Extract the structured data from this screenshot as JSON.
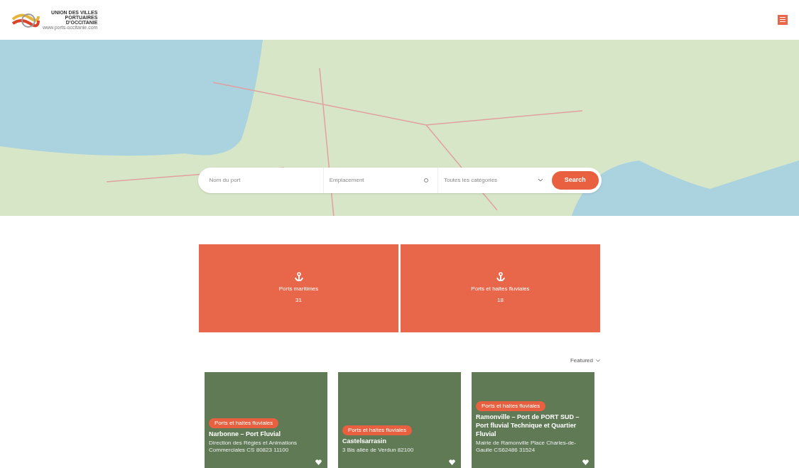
{
  "header": {
    "logo_lines": [
      "UNION DES VILLES",
      "PORTUAIRES",
      "D'OCCITANIE"
    ],
    "logo_url": "www.ports-occitanie.com"
  },
  "search": {
    "fields": [
      {
        "kind": "text",
        "placeholder": "Nom du port"
      },
      {
        "kind": "location",
        "placeholder": "Emplacement"
      },
      {
        "kind": "select",
        "placeholder": "Toutes les catégories"
      }
    ],
    "button": "Search"
  },
  "categories": [
    {
      "label": "Ports maritimes",
      "count": "31"
    },
    {
      "label": "Ports et haltes fluviales",
      "count": "18"
    }
  ],
  "sort": "Featured",
  "listings": [
    {
      "badge": "Ports et haltes fluviales",
      "title": "Narbonne – Port Fluvial",
      "address": "Direction des Régies et Animations Commerciales CS 80823 11100"
    },
    {
      "badge": "Ports et haltes fluviales",
      "title": "Castelsarrasin",
      "address": "3 Bis allée de Verdun 82100"
    },
    {
      "badge": "Ports et haltes fluviales",
      "title": "Ramonville – Port de PORT SUD – Port fluvial Technique et Quartier Fluvial",
      "address": "Mairie de Ramonville Place Charles-de-Gaulle CS62486 31524"
    }
  ]
}
